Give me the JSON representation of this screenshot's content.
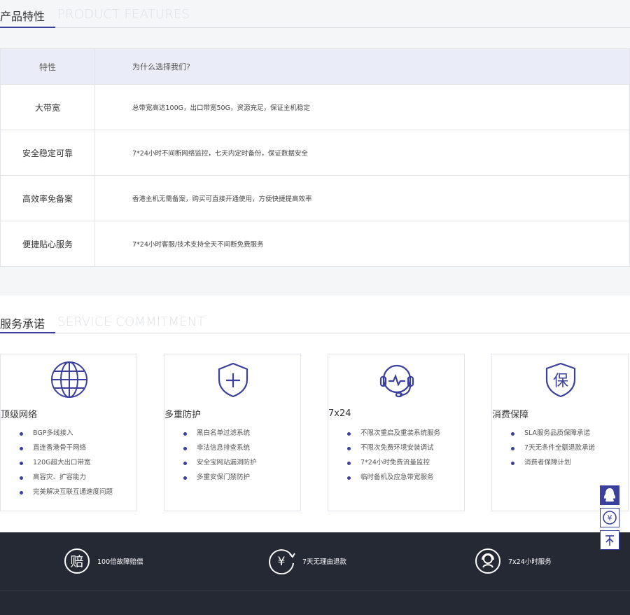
{
  "features": {
    "title_cn": "产品特性",
    "title_en": "PRODUCT FEATURES",
    "header": {
      "name": "特性",
      "desc": "为什么选择我们?"
    },
    "rows": [
      {
        "name": "大带宽",
        "desc": "总带宽高达100G，出口带宽50G，资源充足，保证主机稳定"
      },
      {
        "name": "安全稳定可靠",
        "desc": "7*24小时不间断网络监控，七天内定时备份，保证数据安全"
      },
      {
        "name": "高效率免备案",
        "desc": "香港主机无需备案，购买可直接开通使用，方便快捷提高效率"
      },
      {
        "name": "便捷贴心服务",
        "desc": "7*24小时客服/技术支持全天不间断免费服务"
      }
    ]
  },
  "service": {
    "title_cn": "服务承诺",
    "title_en": "SERVICE COMMITMENT",
    "cards": [
      {
        "icon": "globe-icon",
        "title": "顶级网络",
        "items": [
          "BGP多线接入",
          "直连香港骨干网络",
          "120G超大出口带宽",
          "高容灾、扩容能力",
          "完美解决互联互通速度问题"
        ]
      },
      {
        "icon": "shield-plus-icon",
        "title": "多重防护",
        "items": [
          "黑白名单过滤系统",
          "非法信息排查系统",
          "安全宝网站漏洞防护",
          "多重安保门禁防护"
        ]
      },
      {
        "icon": "headset-icon",
        "title": "7x24",
        "items": [
          "不限次重启及重装系统服务",
          "不限次免费环境安装调试",
          "7*24小时免费流量监控",
          "临时备机及应急带宽服务"
        ]
      },
      {
        "icon": "bao-shield-icon",
        "title": "消费保障",
        "items": [
          "SLA服务品质保障承诺",
          "7天无条件全额退款承诺",
          "消费者保障计划"
        ]
      }
    ]
  },
  "footer": {
    "guarantees": [
      {
        "icon": "compensation-icon",
        "glyph": "赔",
        "label": "100倍故障赔偿"
      },
      {
        "icon": "refund-icon",
        "glyph": "¥",
        "label": "7天无理由退款"
      },
      {
        "icon": "support-icon",
        "glyph": "",
        "label": "7x24小时服务"
      }
    ]
  },
  "floating": {
    "qq_icon": "qq-penguin-icon",
    "pay_icon": "yuan-circle-icon",
    "top_icon": "back-to-top-icon"
  },
  "colors": {
    "accent": "#3b3f9e",
    "table_header_bg": "#eaedf7",
    "footer_bg": "#252934",
    "page_bg": "#f5f6f8"
  }
}
